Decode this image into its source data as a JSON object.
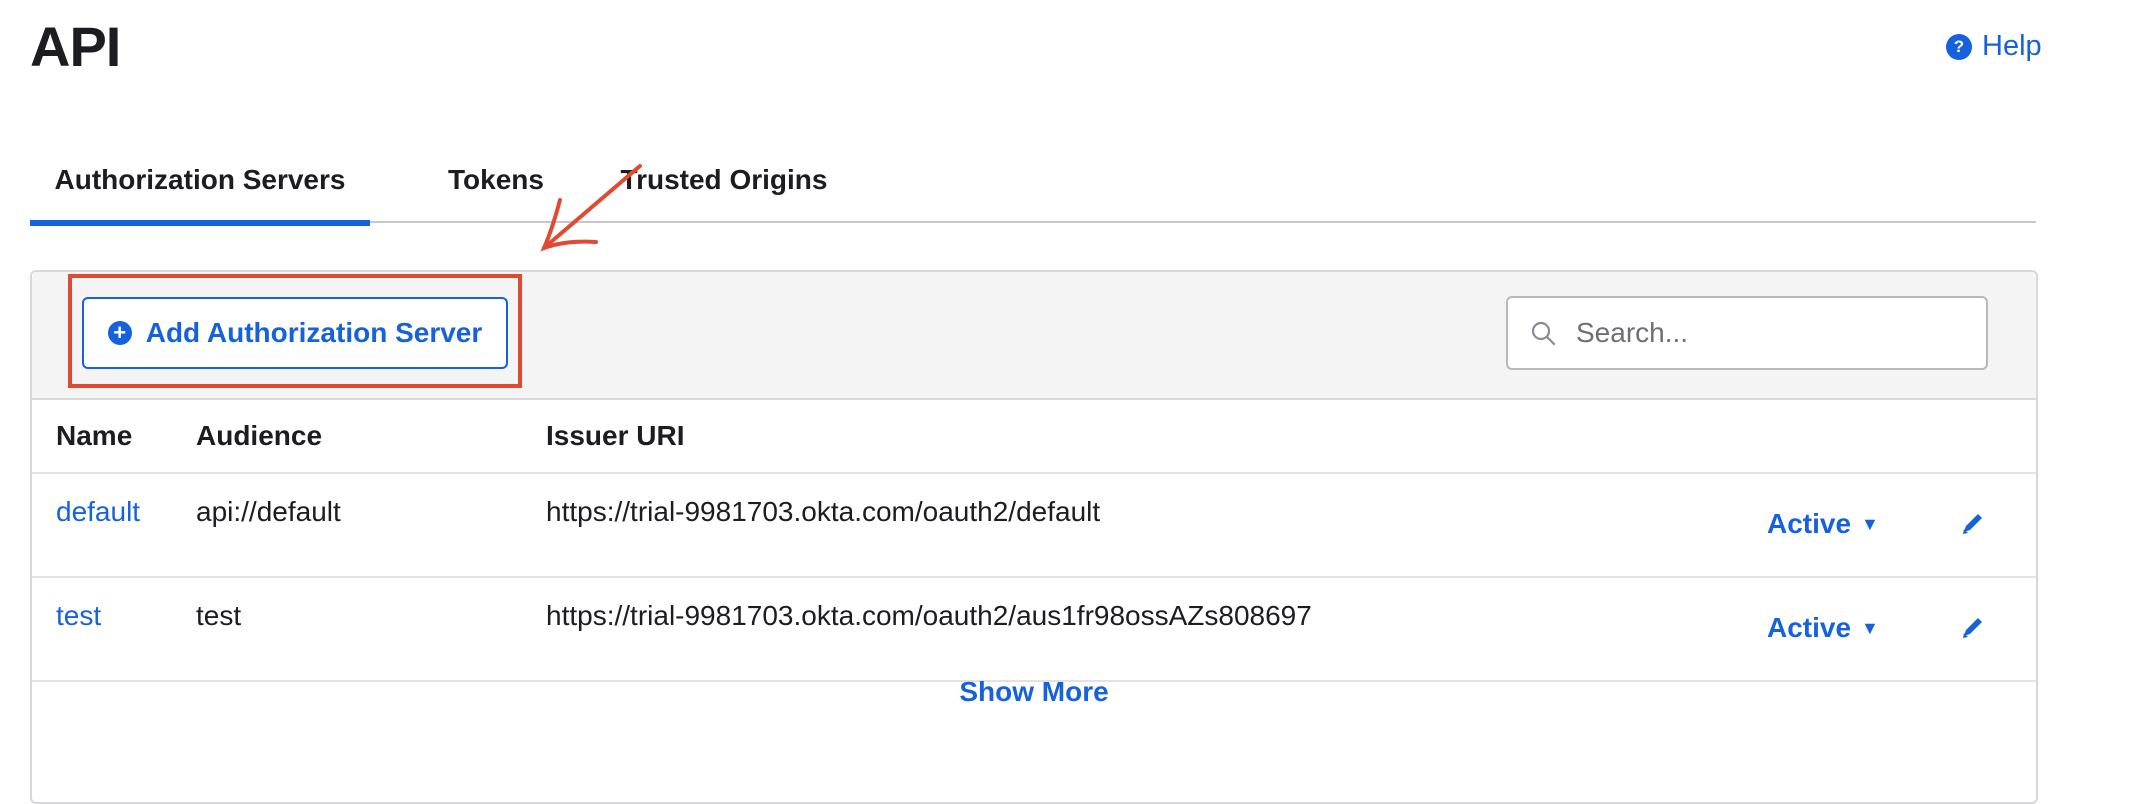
{
  "page": {
    "title": "API",
    "help_label": "Help"
  },
  "tabs": [
    {
      "label": "Authorization Servers",
      "active": true
    },
    {
      "label": "Tokens",
      "active": false
    },
    {
      "label": "Trusted Origins",
      "active": false
    }
  ],
  "toolbar": {
    "add_button_label": "Add Authorization Server",
    "search_placeholder": "Search..."
  },
  "table": {
    "columns": [
      "Name",
      "Audience",
      "Issuer URI"
    ],
    "rows": [
      {
        "name": "default",
        "audience": "api://default",
        "issuer_uri": "https://trial-9981703.okta.com/oauth2/default",
        "status": "Active"
      },
      {
        "name": "test",
        "audience": "test",
        "issuer_uri": "https://trial-9981703.okta.com/oauth2/aus1fr98ossAZs808697",
        "status": "Active"
      }
    ],
    "show_more_label": "Show More"
  },
  "colors": {
    "accent": "#1662dd",
    "annotation": "#e04a32"
  },
  "icons": [
    "help-icon",
    "plus-circle-icon",
    "search-icon",
    "caret-down-icon",
    "pencil-icon"
  ]
}
